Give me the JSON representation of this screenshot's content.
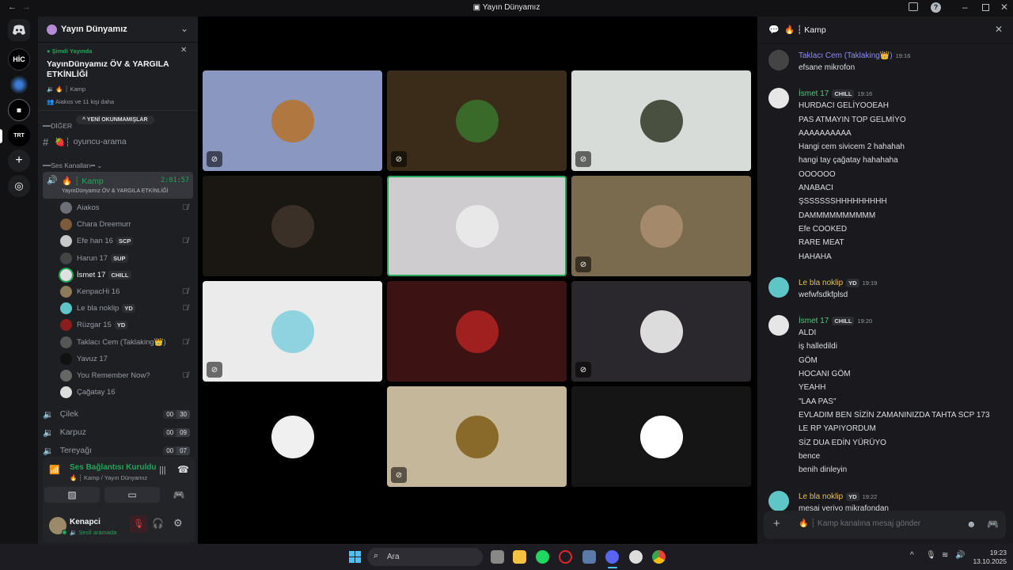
{
  "window": {
    "title": "Yayın Dünyamız"
  },
  "servers": [
    {
      "label": "HİC"
    },
    {
      "label": "TRT"
    }
  ],
  "guild": {
    "name": "Yayın Dünyamız",
    "live": {
      "status": "Şimdi Yayında",
      "title_line1": "YayınDünyamız ÖV & YARGILA",
      "title_line2": "ETKİNLİĞİ",
      "channel": "Kamp",
      "viewers": "Aiakos ve 11 kişi daha"
    },
    "other_category": "DİĞER",
    "unread_pill": "YENİ OKUNMAMIŞLAR",
    "text_channel": "oyuncu-arama",
    "voice_category": "Ses Kanalları",
    "active_voice": {
      "name": "Kamp",
      "timer": "2:01:57",
      "subtitle": "YayınDünyamız ÖV & YARGILA ETKİNLİĞİ"
    },
    "members": [
      {
        "name": "Aiakos",
        "badge": "",
        "muted": true,
        "color": "#6d6f78"
      },
      {
        "name": "Chara Dreemurr",
        "badge": "",
        "muted": false,
        "color": "#7a5b3a"
      },
      {
        "name": "Efe han 16",
        "badge": "SCP",
        "muted": true,
        "color": "#c9c9c9"
      },
      {
        "name": "Harun 17",
        "badge": "SUP",
        "muted": false,
        "color": "#444"
      },
      {
        "name": "İsmet 17",
        "badge": "CHILL",
        "muted": false,
        "color": "#e0e0e0",
        "active": true
      },
      {
        "name": "KenpacHi 16",
        "badge": "",
        "muted": true,
        "color": "#8b7b5a"
      },
      {
        "name": "Le bla noklip",
        "badge": "YD",
        "muted": true,
        "color": "#5fc6c8"
      },
      {
        "name": "Rüzgar 15",
        "badge": "YD",
        "muted": false,
        "color": "#8a1e1e"
      },
      {
        "name": "Taklacı Cem (Taklaking👑)",
        "badge": "",
        "muted": true,
        "color": "#555"
      },
      {
        "name": "Yavuz 17",
        "badge": "",
        "muted": false,
        "color": "#111"
      },
      {
        "name": "You Remember Now?",
        "badge": "",
        "muted": true,
        "color": "#666"
      },
      {
        "name": "Çağatay 16",
        "badge": "",
        "muted": false,
        "color": "#ddd"
      }
    ],
    "other_voice": [
      {
        "name": "Çilek",
        "a": "00",
        "b": "30"
      },
      {
        "name": "Karpuz",
        "a": "00",
        "b": "09"
      },
      {
        "name": "Tereyağı",
        "a": "00",
        "b": "07"
      }
    ]
  },
  "voice_panel": {
    "status": "Ses Bağlantısı Kuruldu",
    "location": "Kamp / Yayın Dünyamız"
  },
  "user_panel": {
    "name": "Kenapci",
    "status": "Sesli aramada"
  },
  "tiles": [
    {
      "bg": "#8a97c0",
      "av": "#b07840",
      "muted": true
    },
    {
      "bg": "#3a2c18",
      "av": "#3a6a2a",
      "muted": true
    },
    {
      "bg": "#d8dcd8",
      "av": "#4a5040",
      "muted": true
    },
    {
      "bg": "#1a1612",
      "av": "#3a3028",
      "muted": false
    },
    {
      "bg": "#cfcccf",
      "av": "#e8e8e8",
      "muted": false,
      "speaking": true
    },
    {
      "bg": "#7a6a4e",
      "av": "#a48a6a",
      "muted": true
    },
    {
      "bg": "#ebebeb",
      "av": "#8fd3e0",
      "muted": true
    },
    {
      "bg": "#3c1212",
      "av": "#a02020",
      "muted": false
    },
    {
      "bg": "#2a282c",
      "av": "#dcdcdc",
      "muted": true
    },
    {
      "bg": "#000000",
      "av": "#f0f0f0",
      "muted": false
    },
    {
      "bg": "#c5b79a",
      "av": "#8a6a2a",
      "muted": true
    },
    {
      "bg": "#151515",
      "av": "#ffffff",
      "muted": false
    }
  ],
  "chat": {
    "channel": "Kamp",
    "placeholder": "Kamp kanalına mesaj gönder",
    "messages": [
      {
        "author": "Taklacı Cem (Taklaking👑)",
        "color": "#8c8cf0",
        "badge": "",
        "time": "19:16",
        "av": "#444",
        "lines": [
          "efsane mikrofon"
        ]
      },
      {
        "author": "İsmet 17",
        "color": "#4ec97b",
        "badge": "CHILL",
        "time": "19:16",
        "av": "#e6e6e6",
        "lines": [
          "HURDACI GELİYOOEAH",
          "PAS ATMAYIN TOP GELMİYO",
          "AAAAAAAAAA",
          "Hangi cem sivicem 2 hahahah",
          "hangi tay çağatay hahahaha",
          "OOOOOO",
          "ANABACI",
          "ŞSSSSSSHHHHHHHHH",
          "DAMMMMMMMMMM",
          "Efe COOKED",
          "RARE MEAT",
          "HAHAHA"
        ]
      },
      {
        "author": "Le bla noklip",
        "color": "#e8c04a",
        "badge": "YD",
        "time": "19:19",
        "av": "#5fc6c8",
        "lines": [
          "wefwfsdkfplsd"
        ]
      },
      {
        "author": "İsmet 17",
        "color": "#4ec97b",
        "badge": "CHILL",
        "time": "19:20",
        "av": "#e6e6e6",
        "lines": [
          "ALDI",
          "iş halledildi",
          "GÖM",
          "HOCANI GÖM",
          "YEAHH",
          "\"LAA PAS\"",
          "EVLADIM BEN SİZİN ZAMANINIZDA TAHTA SCP 173",
          "LE RP YAPIYORDUM",
          "SİZ DUA EDİN YÜRÜYO",
          "bence",
          "benih dinleyin"
        ]
      },
      {
        "author": "Le bla noklip",
        "color": "#e8c04a",
        "badge": "YD",
        "time": "19:22",
        "av": "#5fc6c8",
        "lines": [
          "mesaj veriyo mikrafondan"
        ]
      }
    ]
  },
  "taskbar": {
    "search": "Ara",
    "time": "19:23",
    "date": "13.10.2025"
  }
}
